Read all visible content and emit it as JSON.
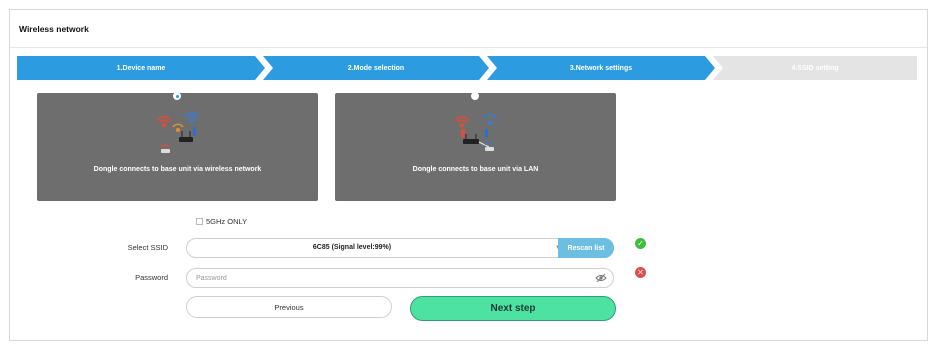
{
  "panel": {
    "title": "Wireless network"
  },
  "wizard": {
    "steps": [
      {
        "label": "1.Device name",
        "state": "complete"
      },
      {
        "label": "2.Mode selection",
        "state": "complete"
      },
      {
        "label": "3.Network settings",
        "state": "current"
      },
      {
        "label": "4.SSID setting",
        "state": "pending"
      }
    ],
    "colors": {
      "active": "#2c9be0",
      "inactive": "#e4e4e4"
    }
  },
  "modes": [
    {
      "label": "Dongle connects to base unit via wireless network",
      "selected": true,
      "icon": "wireless-router-icon"
    },
    {
      "label": "Dongle connects to base unit via LAN",
      "selected": false,
      "icon": "lan-router-icon"
    }
  ],
  "form": {
    "only5ghz_label": "5GHz ONLY",
    "ssid_label": "Select SSID",
    "ssid_value": "6C85 (Signal level:99%)",
    "rescan_label": "Rescan list",
    "password_label": "Password",
    "password_placeholder": "Password",
    "password_value": ""
  },
  "buttons": {
    "previous": "Previous",
    "next": "Next step"
  },
  "colors": {
    "ok": "#3cbf3c",
    "error": "#e44a4a",
    "next": "#4ee2a2",
    "rescan": "#6cbfe0"
  }
}
